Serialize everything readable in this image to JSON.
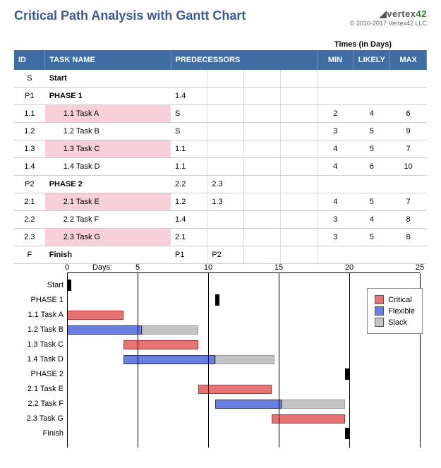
{
  "title": "Critical Path Analysis with Gantt Chart",
  "brand": {
    "name_pre": "vertex",
    "name_suf": "42",
    "copyright": "© 2010-2017 Vertex42 LLC"
  },
  "times_label": "Times (in Days)",
  "table": {
    "headers": {
      "id": "ID",
      "name": "TASK NAME",
      "pred": "PREDECESSORS",
      "min": "MIN",
      "likely": "LIKELY",
      "max": "MAX"
    },
    "rows": [
      {
        "id": "S",
        "name": "Start",
        "bold": true,
        "indent": false,
        "critical": false,
        "preds": [
          "",
          "",
          "",
          ""
        ],
        "min": "",
        "likely": "",
        "max": ""
      },
      {
        "id": "P1",
        "name": "PHASE 1",
        "bold": true,
        "indent": false,
        "critical": false,
        "preds": [
          "1.4",
          "",
          "",
          ""
        ],
        "min": "",
        "likely": "",
        "max": ""
      },
      {
        "id": "1.1",
        "name": "1.1 Task A",
        "bold": false,
        "indent": true,
        "critical": true,
        "preds": [
          "S",
          "",
          "",
          ""
        ],
        "min": "2",
        "likely": "4",
        "max": "6"
      },
      {
        "id": "1.2",
        "name": "1.2 Task B",
        "bold": false,
        "indent": true,
        "critical": false,
        "preds": [
          "S",
          "",
          "",
          ""
        ],
        "min": "3",
        "likely": "5",
        "max": "9"
      },
      {
        "id": "1.3",
        "name": "1.3 Task C",
        "bold": false,
        "indent": true,
        "critical": true,
        "preds": [
          "1.1",
          "",
          "",
          ""
        ],
        "min": "4",
        "likely": "5",
        "max": "7"
      },
      {
        "id": "1.4",
        "name": "1.4 Task D",
        "bold": false,
        "indent": true,
        "critical": false,
        "preds": [
          "1.1",
          "",
          "",
          ""
        ],
        "min": "4",
        "likely": "6",
        "max": "10"
      },
      {
        "id": "P2",
        "name": "PHASE 2",
        "bold": true,
        "indent": false,
        "critical": false,
        "preds": [
          "2.2",
          "2.3",
          "",
          ""
        ],
        "min": "",
        "likely": "",
        "max": ""
      },
      {
        "id": "2.1",
        "name": "2.1 Task E",
        "bold": false,
        "indent": true,
        "critical": true,
        "preds": [
          "1.2",
          "1.3",
          "",
          ""
        ],
        "min": "4",
        "likely": "5",
        "max": "7"
      },
      {
        "id": "2.2",
        "name": "2.2 Task F",
        "bold": false,
        "indent": true,
        "critical": false,
        "preds": [
          "1.4",
          "",
          "",
          ""
        ],
        "min": "3",
        "likely": "4",
        "max": "8"
      },
      {
        "id": "2.3",
        "name": "2.3 Task G",
        "bold": false,
        "indent": true,
        "critical": true,
        "preds": [
          "2.1",
          "",
          "",
          ""
        ],
        "min": "3",
        "likely": "5",
        "max": "8"
      },
      {
        "id": "F",
        "name": "Finish",
        "bold": true,
        "indent": false,
        "critical": false,
        "preds": [
          "P1",
          "P2",
          "",
          ""
        ],
        "min": "",
        "likely": "",
        "max": ""
      }
    ]
  },
  "legend": {
    "critical": "Critical",
    "flexible": "Flexible",
    "slack": "Slack"
  },
  "chart_data": {
    "type": "gantt",
    "x_unit": "Days",
    "x_label": "Days:",
    "xlim": [
      0,
      25
    ],
    "ticks": [
      0,
      5,
      10,
      15,
      20,
      25
    ],
    "rows": [
      {
        "label": "Start",
        "bars": [
          {
            "kind": "milestone",
            "at": 0
          }
        ]
      },
      {
        "label": "PHASE 1",
        "bars": [
          {
            "kind": "milestone",
            "at": 10.5
          }
        ]
      },
      {
        "label": "1.1 Task A",
        "bars": [
          {
            "kind": "critical",
            "start": 0,
            "end": 4
          }
        ]
      },
      {
        "label": "1.2 Task B",
        "bars": [
          {
            "kind": "flexible",
            "start": 0,
            "end": 5.3
          },
          {
            "kind": "slack",
            "start": 5.3,
            "end": 9.3
          }
        ]
      },
      {
        "label": "1.3 Task C",
        "bars": [
          {
            "kind": "critical",
            "start": 4,
            "end": 9.3
          }
        ]
      },
      {
        "label": "1.4 Task D",
        "bars": [
          {
            "kind": "flexible",
            "start": 4,
            "end": 10.5
          },
          {
            "kind": "slack",
            "start": 10.5,
            "end": 14.7
          }
        ]
      },
      {
        "label": "PHASE 2",
        "bars": [
          {
            "kind": "milestone",
            "at": 19.7
          }
        ]
      },
      {
        "label": "2.1 Task E",
        "bars": [
          {
            "kind": "critical",
            "start": 9.3,
            "end": 14.5
          }
        ]
      },
      {
        "label": "2.2 Task F",
        "bars": [
          {
            "kind": "flexible",
            "start": 10.5,
            "end": 15.2
          },
          {
            "kind": "slack",
            "start": 15.2,
            "end": 19.7
          }
        ]
      },
      {
        "label": "2.3 Task G",
        "bars": [
          {
            "kind": "critical",
            "start": 14.5,
            "end": 19.7
          }
        ]
      },
      {
        "label": "Finish",
        "bars": [
          {
            "kind": "milestone",
            "at": 19.7
          }
        ]
      }
    ]
  }
}
